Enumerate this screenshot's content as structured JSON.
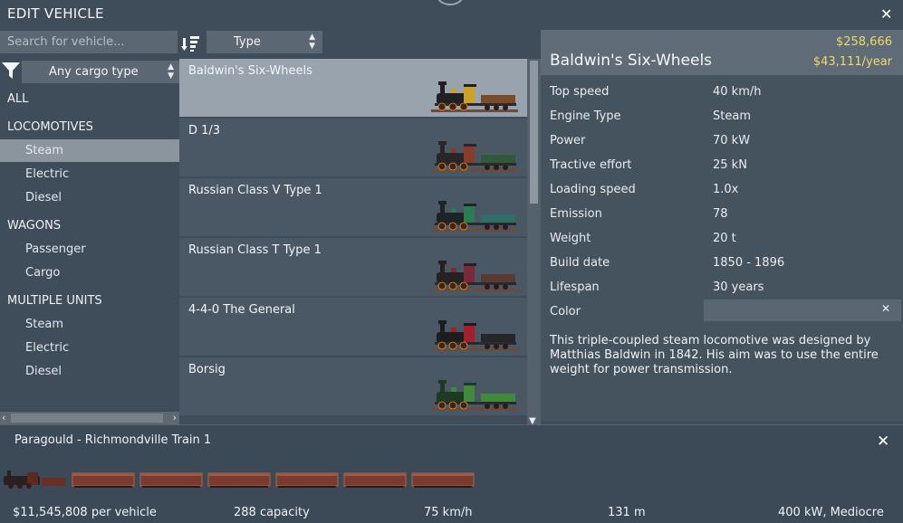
{
  "window": {
    "title": "EDIT VEHICLE"
  },
  "search": {
    "placeholder": "Search for vehicle..."
  },
  "sort": {
    "label": "Type"
  },
  "filter": {
    "cargo_label": "Any cargo type"
  },
  "categories": [
    {
      "label": "ALL",
      "kind": "head"
    },
    {
      "label": "LOCOMOTIVES",
      "kind": "head"
    },
    {
      "label": "Steam",
      "kind": "sub",
      "selected": true
    },
    {
      "label": "Electric",
      "kind": "sub"
    },
    {
      "label": "Diesel",
      "kind": "sub"
    },
    {
      "label": "WAGONS",
      "kind": "head"
    },
    {
      "label": "Passenger",
      "kind": "sub"
    },
    {
      "label": "Cargo",
      "kind": "sub"
    },
    {
      "label": "MULTIPLE UNITS",
      "kind": "head"
    },
    {
      "label": "Steam",
      "kind": "sub"
    },
    {
      "label": "Electric",
      "kind": "sub"
    },
    {
      "label": "Diesel",
      "kind": "sub"
    }
  ],
  "vehicles": [
    {
      "name": "Baldwin's Six-Wheels",
      "selected": true,
      "body": "#1f1f24",
      "accent": "#c9a227",
      "tender": "#7a4a2a"
    },
    {
      "name": "D 1/3",
      "body": "#2a2526",
      "accent": "#8a3c2a",
      "tender": "#2f5a3a"
    },
    {
      "name": "Russian Class V Type 1",
      "body": "#1e2426",
      "accent": "#2e7a55",
      "tender": "#2e6e66"
    },
    {
      "name": "Russian Class T Type 1",
      "body": "#252022",
      "accent": "#7a2a3a",
      "tender": "#5a3a30"
    },
    {
      "name": "4-4-0 The General",
      "body": "#1d1d20",
      "accent": "#a0202c",
      "tender": "#26262a"
    },
    {
      "name": "Borsig",
      "body": "#1e3a22",
      "accent": "#3f8a3c",
      "tender": "#3f8a3c"
    }
  ],
  "detail": {
    "name": "Baldwin's Six-Wheels",
    "price": "$258,666",
    "upkeep": "$43,111/year",
    "specs": [
      {
        "label": "Top speed",
        "value": "40 km/h"
      },
      {
        "label": "Engine Type",
        "value": "Steam"
      },
      {
        "label": "Power",
        "value": "70 kW"
      },
      {
        "label": "Tractive effort",
        "value": "25 kN"
      },
      {
        "label": "Loading speed",
        "value": "1.0x"
      },
      {
        "label": "Emission",
        "value": "78"
      },
      {
        "label": "Weight",
        "value": "20 t"
      },
      {
        "label": "Build date",
        "value": "1850 - 1896"
      },
      {
        "label": "Lifespan",
        "value": "30 years"
      },
      {
        "label": "Color",
        "value": ""
      }
    ],
    "description": "This triple-coupled steam locomotive was designed by Matthias Baldwin in 1842. His aim was to use the entire weight for power transmission."
  },
  "train": {
    "name": "Paragould - Richmondville Train 1",
    "wagon_count": 6,
    "stats": [
      {
        "text": "$11,545,808 per vehicle"
      },
      {
        "text": "288 capacity"
      },
      {
        "text": "75 km/h"
      },
      {
        "text": "131 m"
      },
      {
        "text": "400 kW, Mediocre"
      }
    ]
  },
  "icons": {
    "close": "close-icon",
    "sort": "sort-descending-icon",
    "filter": "filter-funnel-icon"
  }
}
